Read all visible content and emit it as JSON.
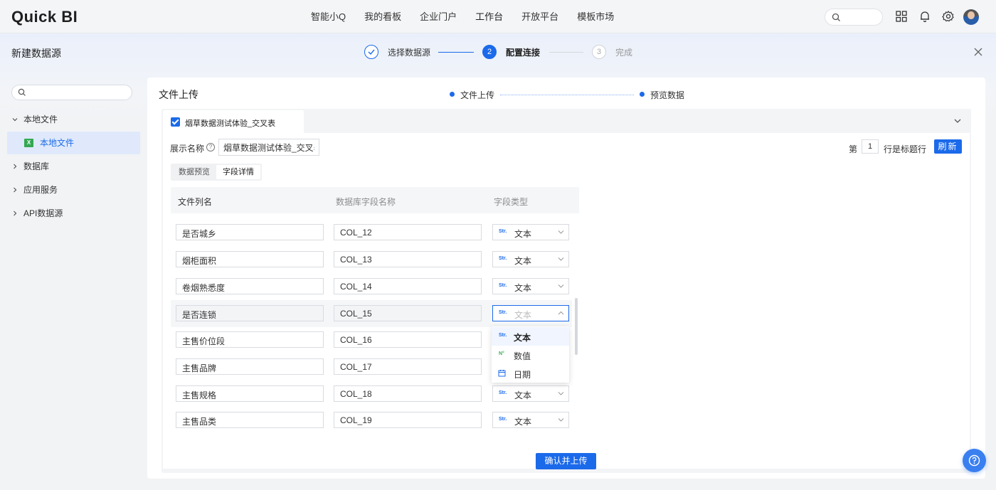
{
  "app": {
    "logo": "Quick BI"
  },
  "topnav": {
    "items": [
      {
        "label": "智能小Q"
      },
      {
        "label": "我的看板"
      },
      {
        "label": "企业门户"
      },
      {
        "label": "工作台",
        "active": true
      },
      {
        "label": "开放平台"
      },
      {
        "label": "模板市场"
      }
    ],
    "icons": [
      "search-icon",
      "apps-grid-icon",
      "bell-icon",
      "gear-icon",
      "avatar"
    ]
  },
  "modal": {
    "title": "新建数据源",
    "steps": [
      {
        "number": "1",
        "label": "选择数据源",
        "state": "done"
      },
      {
        "number": "2",
        "label": "配置连接",
        "state": "active"
      },
      {
        "number": "3",
        "label": "完成",
        "state": "pending"
      }
    ]
  },
  "sidebar": {
    "search_placeholder": "",
    "items": [
      {
        "label": "本地文件",
        "expanded": true
      },
      {
        "label": "本地文件",
        "child": true,
        "selected": true,
        "icon": "excel-icon"
      },
      {
        "label": "数据库"
      },
      {
        "label": "应用服务"
      },
      {
        "label": "API数据源"
      }
    ]
  },
  "main": {
    "title": "文件上传",
    "substeps": [
      {
        "label": "文件上传"
      },
      {
        "label": "预览数据"
      }
    ],
    "file_tab": "烟草数据测试体验_交叉表",
    "display_name_label": "展示名称",
    "display_name_value": "烟草数据测试体验_交叉表",
    "header_row_prefix": "第",
    "header_row_value": "1",
    "header_row_suffix": "行是标题行",
    "refresh_button": "刷新",
    "view_tabs": [
      {
        "label": "数据预览",
        "active": false
      },
      {
        "label": "字段详情",
        "active": true
      }
    ],
    "columns": [
      "文件列名",
      "数据库字段名称",
      "字段类型"
    ],
    "rows": [
      {
        "name": "是否城乡",
        "col": "COL_12",
        "type": "文本"
      },
      {
        "name": "烟柜面积",
        "col": "COL_13",
        "type": "文本"
      },
      {
        "name": "卷烟熟悉度",
        "col": "COL_14",
        "type": "文本"
      },
      {
        "name": "是否连锁",
        "col": "COL_15",
        "type": "文本",
        "open": true
      },
      {
        "name": "主售价位段",
        "col": "COL_16",
        "type": ""
      },
      {
        "name": "主售品牌",
        "col": "COL_17",
        "type": ""
      },
      {
        "name": "主售规格",
        "col": "COL_18",
        "type": "文本"
      },
      {
        "name": "主售品类",
        "col": "COL_19",
        "type": "文本"
      }
    ],
    "type_tag": "Str.",
    "dropdown": [
      {
        "label": "文本",
        "icon_text": "Str.",
        "selected": true
      },
      {
        "label": "数值",
        "icon_text": "N°"
      },
      {
        "label": "日期",
        "icon": "calendar-icon"
      }
    ],
    "confirm_button": "确认并上传"
  },
  "colors": {
    "accent": "#1b6aea",
    "excel": "#34a853",
    "number": "#3fae5a"
  }
}
